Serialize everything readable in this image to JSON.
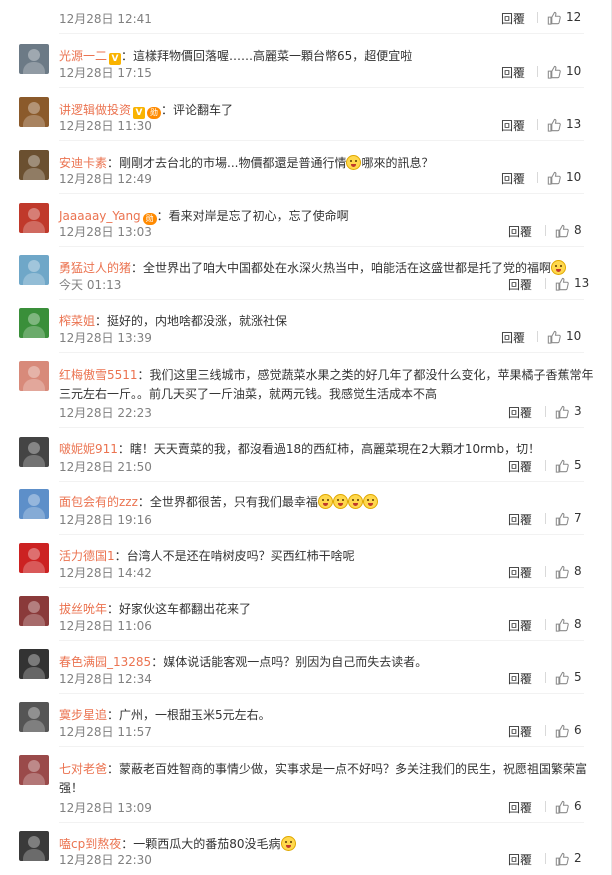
{
  "comments": [
    {
      "user": "",
      "text": "",
      "time": "12月28日 12:41",
      "likes": "12",
      "vip": false,
      "medal": false,
      "emoji": 0,
      "avatar": "#999999"
    },
    {
      "user": "光源一二",
      "text": "：這樣拜物價回落喔……高麗菜一顆台幣65，超便宜啦",
      "time": "12月28日 17:15",
      "likes": "10",
      "vip": true,
      "medal": false,
      "emoji": 0,
      "avatar": "#6c7a86"
    },
    {
      "user": "讲逻辑做投资",
      "text": "：评论翻车了",
      "time": "12月28日 11:30",
      "likes": "13",
      "vip": true,
      "medal": true,
      "emoji": 0,
      "avatar": "#8b5a2b"
    },
    {
      "user": "安迪卡素",
      "text": "：剛剛才去台北的市場...物價都還是普通行情",
      "text2": "哪來的訊息？",
      "time": "12月28日 12:49",
      "likes": "10",
      "vip": false,
      "medal": false,
      "emoji": 1,
      "avatar": "#6b5030"
    },
    {
      "user": "Jaaaaay_Yang",
      "text": "：看来对岸是忘了初心，忘了使命啊",
      "time": "12月28日 13:03",
      "likes": "8",
      "vip": false,
      "medal": true,
      "emoji": 0,
      "avatar": "#c0392b"
    },
    {
      "user": "勇猛过人的猪",
      "text": "：全世界出了咱大中国都处在水深火热当中，咱能活在这盛世都是托了党的福啊",
      "text2": "",
      "time": "今天 01:13",
      "likes": "13",
      "vip": false,
      "medal": false,
      "emoji": 1,
      "avatar": "#6fa7c8"
    },
    {
      "user": "榨菜姐",
      "text": "：挺好的，内地啥都没涨，就涨社保",
      "time": "12月28日 13:39",
      "likes": "10",
      "vip": false,
      "medal": false,
      "emoji": 0,
      "avatar": "#3a8f3a"
    },
    {
      "user": "红梅傲雪5511",
      "text": "：我们这里三线城市，感觉蔬菜水果之类的好几年了都没什么变化，苹果橘子香蕉常年三元左右一斤。。前几天买了一斤油菜，就两元钱。我感觉生活成本不高",
      "time": "12月28日 22:23",
      "likes": "3",
      "vip": false,
      "medal": false,
      "emoji": 0,
      "avatar": "#d88a7a"
    },
    {
      "user": "啵妮妮911",
      "text": "：瞎！天天賣菜的我，都沒看過18的西紅柿，高麗菜現在2大顆才10rmb，切！",
      "time": "12月28日 21:50",
      "likes": "5",
      "vip": false,
      "medal": false,
      "emoji": 0,
      "avatar": "#444444"
    },
    {
      "user": "面包会有的zzz",
      "text": "：全世界都很苦，只有我们最幸福",
      "text2": "",
      "time": "12月28日 19:16",
      "likes": "7",
      "vip": false,
      "medal": false,
      "emoji": 4,
      "avatar": "#5d8fc9"
    },
    {
      "user": "活力德国1",
      "text": "：台湾人不是还在啃树皮吗？买西红柿干啥呢",
      "time": "12月28日 14:42",
      "likes": "8",
      "vip": false,
      "medal": false,
      "emoji": 0,
      "avatar": "#cc2222"
    },
    {
      "user": "拔丝吮年",
      "text": "：好家伙这车都翻出花来了",
      "time": "12月28日 11:06",
      "likes": "8",
      "vip": false,
      "medal": false,
      "emoji": 0,
      "avatar": "#8a3a3a"
    },
    {
      "user": "春色满园_13285",
      "text": "：媒体说话能客观一点吗？别因为自己而失去读者。",
      "time": "12月28日 12:34",
      "likes": "5",
      "vip": false,
      "medal": false,
      "emoji": 0,
      "avatar": "#333333"
    },
    {
      "user": "寞步星追",
      "text": "：广州，一根甜玉米5元左右。",
      "time": "12月28日 11:57",
      "likes": "6",
      "vip": false,
      "medal": false,
      "emoji": 0,
      "avatar": "#555555"
    },
    {
      "user": "七对老爸",
      "text": "：蒙蔽老百姓智商的事情少做，实事求是一点不好吗？多关注我们的民生，祝愿祖国繁荣富强！",
      "time": "12月28日 13:09",
      "likes": "6",
      "vip": false,
      "medal": false,
      "emoji": 0,
      "avatar": "#9a4a4a"
    },
    {
      "user": "嗑cp到熬夜",
      "text": "：一颗西瓜大的番茄80没毛病",
      "text2": "",
      "time": "12月28日 22:30",
      "likes": "2",
      "vip": false,
      "medal": false,
      "emoji": 1,
      "avatar": "#3a3a3a"
    }
  ],
  "labels": {
    "reply": "回覆",
    "vip": "V",
    "medal": "勋"
  },
  "colors": {
    "username": "#eb7350",
    "meta": "#808080"
  },
  "icons": {
    "like": "thumbs-up-icon"
  }
}
